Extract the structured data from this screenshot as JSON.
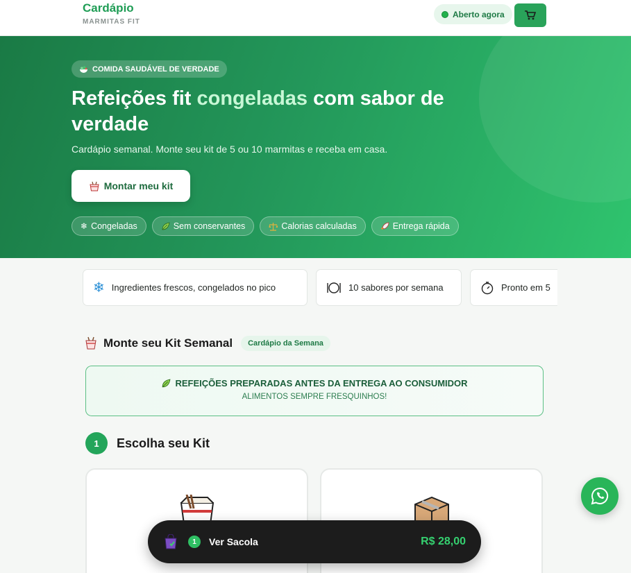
{
  "header": {
    "brand_title": "Cardápio",
    "brand_subtitle": "MARMITAS FIT",
    "status_label": "Aberto agora",
    "cart_icon": "cart-icon"
  },
  "hero": {
    "badge_label": "COMIDA SAUDÁVEL DE VERDADE",
    "title_before": "Refeições fit ",
    "title_highlight": "congeladas",
    "title_after": " com sabor de verdade",
    "subtitle": "Cardápio semanal. Monte seu kit de 5 ou 10 marmitas e receba em casa.",
    "cta_label": "Montar meu kit",
    "tags": [
      {
        "icon": "snowflake-icon",
        "label": "Congeladas"
      },
      {
        "icon": "leaf-icon",
        "label": "Sem conservantes"
      },
      {
        "icon": "scale-icon",
        "label": "Calorias calculadas"
      },
      {
        "icon": "rocket-icon",
        "label": "Entrega rápida"
      }
    ]
  },
  "features": [
    {
      "icon": "snowflake-icon",
      "label": "Ingredientes frescos, congelados no pico"
    },
    {
      "icon": "plate-icon",
      "label": "10 sabores por semana"
    },
    {
      "icon": "stopwatch-icon",
      "label": "Pronto em 5"
    }
  ],
  "kit_section": {
    "title": "Monte seu Kit Semanal",
    "pill": "Cardápio da Semana",
    "notice_title": "REFEIÇÕES PREPARADAS ANTES DA ENTREGA AO CONSUMIDOR",
    "notice_subtitle": "ALIMENTOS SEMPRE FRESQUINHOS!",
    "step_number": "1",
    "step_title": "Escolha seu Kit",
    "cards": [
      {
        "icon": "takeout-box-icon"
      },
      {
        "icon": "package-icon"
      }
    ]
  },
  "bag": {
    "count": "1",
    "label": "Ver Sacola",
    "total": "R$ 28,00"
  },
  "colors": {
    "brand": "#1f9d55",
    "hero_start": "#1a7a45",
    "hero_end": "#2fc46e",
    "bag_bar": "#1c1c1c"
  }
}
